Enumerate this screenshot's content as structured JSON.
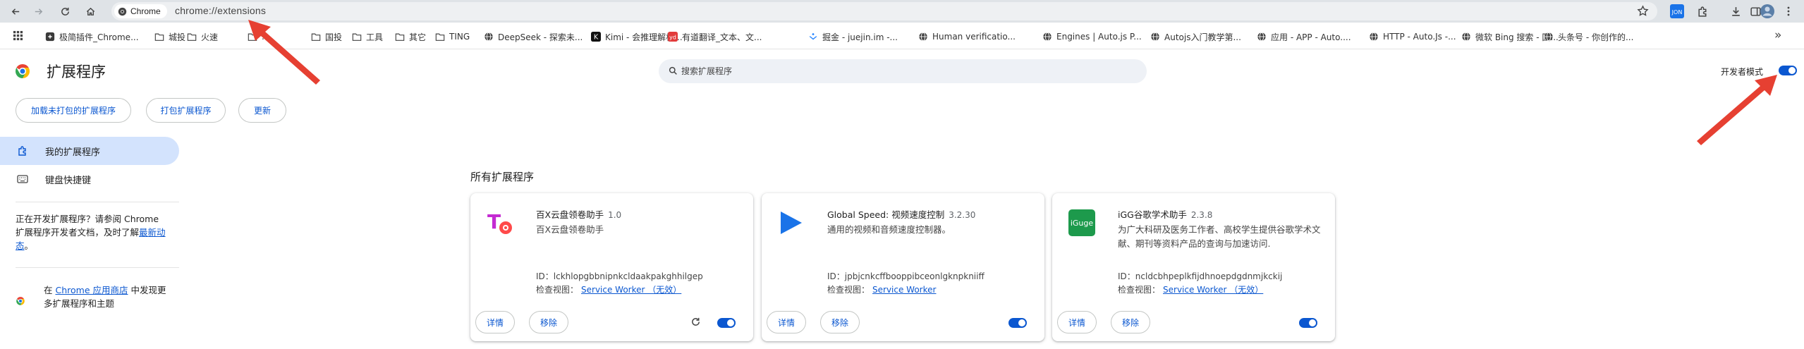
{
  "browser": {
    "chip_label": "Chrome",
    "url": "chrome://extensions"
  },
  "bookmarks": [
    {
      "label": "极简插件_Chrome...",
      "icon": "puzzle-icon"
    },
    {
      "label": "城投",
      "icon": "folder-icon"
    },
    {
      "label": "火速",
      "icon": "folder-icon"
    },
    {
      "label": "...",
      "icon": "folder-icon"
    },
    {
      "label": "国投",
      "icon": "folder-icon"
    },
    {
      "label": "工具",
      "icon": "folder-icon"
    },
    {
      "label": "其它",
      "icon": "folder-icon"
    },
    {
      "label": "TING",
      "icon": "folder-icon"
    },
    {
      "label": "DeepSeek - 探索未...",
      "icon": "globe-icon"
    },
    {
      "label": "Kimi - 会推理解析...",
      "icon": "kimi-icon"
    },
    {
      "label": "有道翻译_文本、文...",
      "icon": "youdao-icon"
    },
    {
      "label": "掘金 - juejin.im -...",
      "icon": "juejin-icon"
    },
    {
      "label": "Human verificatio...",
      "icon": "globe-icon"
    },
    {
      "label": "Engines | Auto.js P...",
      "icon": "globe-icon"
    },
    {
      "label": "Autojs入门教学第...",
      "icon": "globe-icon"
    },
    {
      "label": "应用 - APP - Auto....",
      "icon": "globe-icon"
    },
    {
      "label": "HTTP - Auto.Js -...",
      "icon": "globe-icon"
    },
    {
      "label": "微软 Bing 搜索 - 国...",
      "icon": "globe-icon"
    },
    {
      "label": "头条号 - 你创作的...",
      "icon": "globe-icon"
    }
  ],
  "bookmarks_overflow": "»",
  "header": {
    "title": "扩展程序",
    "search_placeholder": "搜索扩展程序",
    "dev_mode_label": "开发者模式"
  },
  "dev_mode_on": true,
  "actions": {
    "load_unpacked": "加载未打包的扩展程序",
    "pack": "打包扩展程序",
    "update": "更新"
  },
  "sidebar": {
    "items": [
      {
        "label": "我的扩展程序"
      },
      {
        "label": "键盘快捷键"
      }
    ],
    "dev_text": "正在开发扩展程序？请参阅 Chrome 扩展程序开发者文档，及时了解",
    "dev_link": "最新动态",
    "dev_text_end": "。",
    "store_prefix": "在 ",
    "store_link": "Chrome 应用商店",
    "store_suffix": " 中发现更多扩展程序和主题"
  },
  "main": {
    "section_title": "所有扩展程序",
    "details_label": "详情",
    "remove_label": "移除",
    "id_prefix": "ID：",
    "inspect_prefix": "检查视图：",
    "extensions": [
      {
        "name": "百X云盘领卷助手",
        "version": "1.0",
        "description": "百X云盘领卷助手",
        "id": "lckhlopgbbnipnkcldaakpakghhilgep",
        "inspect_link": "Service Worker （无效）",
        "enabled": true
      },
      {
        "name": "Global Speed: 视频速度控制",
        "version": "3.2.30",
        "description": "通用的视频和音频速度控制器。",
        "id": "jpbjcnkcffbooppibceonlgknpkniiff",
        "inspect_link": "Service Worker",
        "enabled": true
      },
      {
        "name": "iGG谷歌学术助手",
        "version": "2.3.8",
        "description": "为广大科研及医务工作者、高校学生提供谷歌学术文献、期刊等资料产品的查询与加速访问.",
        "id": "ncldcbhpeplkfijdhnoepdgdnmjkckij",
        "inspect_link": "Service Worker （无效）",
        "enabled": true
      }
    ]
  },
  "colors": {
    "accent": "#0b57d0",
    "active_nav_bg": "#d3e3fd",
    "arrow": "#e64032"
  }
}
